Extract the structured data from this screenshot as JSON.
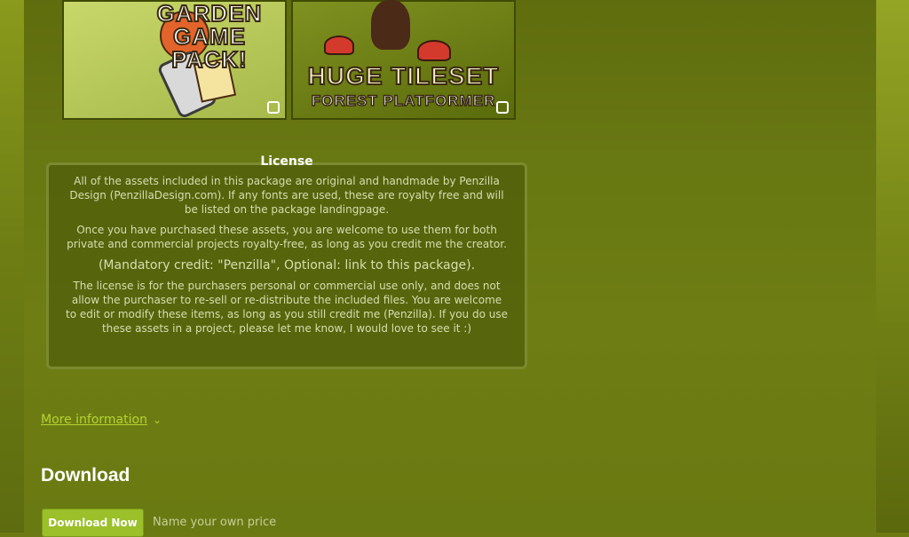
{
  "thumbnails": [
    {
      "title": "GARDEN\nGAME\nPACK!",
      "subtitle": ""
    },
    {
      "title": "HUGE TILESET",
      "subtitle": "FOREST PLATFORMER"
    }
  ],
  "license": {
    "heading": "License",
    "paragraph_1": "All of the assets included in this package are original and handmade by Penzilla Design (PenzillaDesign.com). If any fonts are used, these are royalty free and will be listed on the package landingpage.",
    "paragraph_2": "Once you have purchased these assets, you are welcome to use them for both private and commercial projects royalty-free, as long as you  credit me the creator.",
    "credit_line": "(Mandatory credit: \"Penzilla\", Optional: link to this package).",
    "paragraph_3": "The license is for the purchasers personal or commercial use only, and does not allow the purchaser to re-sell or re-distribute the included files. You are welcome to edit or modify these items, as long as you still credit me (Penzilla). If you do use these assets in a project, please let me know, I would love to see it :)"
  },
  "more_info": {
    "label": "More information",
    "icon": "chevron-down-icon"
  },
  "download": {
    "heading": "Download",
    "button_label": "Download Now",
    "price_label": "Name your own price"
  },
  "colors": {
    "background": "#6b7a12",
    "accent": "#9bc02a",
    "link": "#b5d330"
  }
}
